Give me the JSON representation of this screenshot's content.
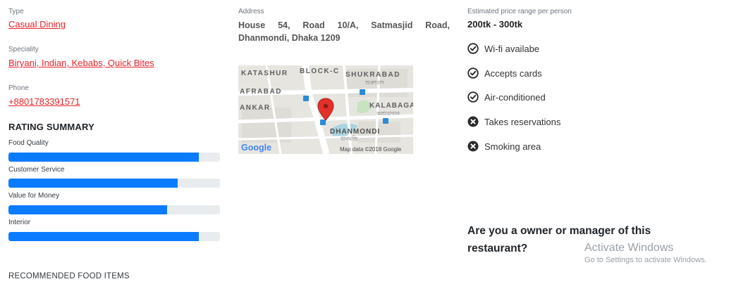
{
  "details": {
    "type_label": "Type",
    "type_value": "Casual Dining",
    "speciality_label": "Speciality",
    "speciality_value": "Biryani, Indian, Kebabs, Quick Bites",
    "phone_label": "Phone",
    "phone_value": "+8801783391571"
  },
  "rating_summary": {
    "title": "RATING SUMMARY",
    "items": [
      {
        "label": "Food Quality",
        "fill_fraction": 0.9
      },
      {
        "label": "Customer Service",
        "fill_fraction": 0.8
      },
      {
        "label": "Value for Money",
        "fill_fraction": 0.75
      },
      {
        "label": "Interior",
        "fill_fraction": 0.9
      }
    ],
    "bar_color": "#0b7bff",
    "track_color": "#e9ecef"
  },
  "address": {
    "label": "Address",
    "value": "House 54, Road 10/A, Satmasjid Road, Dhanmondi, Dhaka 1209"
  },
  "map": {
    "labels": {
      "katashur": "KATASHUR",
      "block_c": "BLOCK-C",
      "shukrabad": "SHUKRABAD",
      "shukrabad_bn": "শুক্রাবাদ",
      "afrabad": "AFRABAD",
      "ankar": "ANKAR",
      "kalabagan": "KALABAGA",
      "kalabagan_bn": "কলাবাগান",
      "dhanmondi": "DHANMONDI",
      "dhanmondi_bn": "ধানমন্ডি"
    },
    "google_logo": "Google",
    "attribution": "Map data ©2018 Google",
    "marker_icon": "map-pin-icon"
  },
  "pricing": {
    "label": "Estimated price range per person",
    "value": "200tk - 300tk"
  },
  "features": [
    {
      "label": "Wi-fi availabe",
      "icon": "check-circle-icon"
    },
    {
      "label": "Accepts cards",
      "icon": "check-circle-icon"
    },
    {
      "label": "Air-conditioned",
      "icon": "check-circle-icon"
    },
    {
      "label": "Takes reservations",
      "icon": "times-circle-icon"
    },
    {
      "label": "Smoking area",
      "icon": "times-circle-icon"
    }
  ],
  "owner_prompt": "Are you a owner or manager of this restaurant?",
  "recommended_title": "RECOMMENDED FOOD ITEMS",
  "watermark": {
    "title": "Activate Windows",
    "subtitle": "Go to Settings to activate Windows."
  }
}
